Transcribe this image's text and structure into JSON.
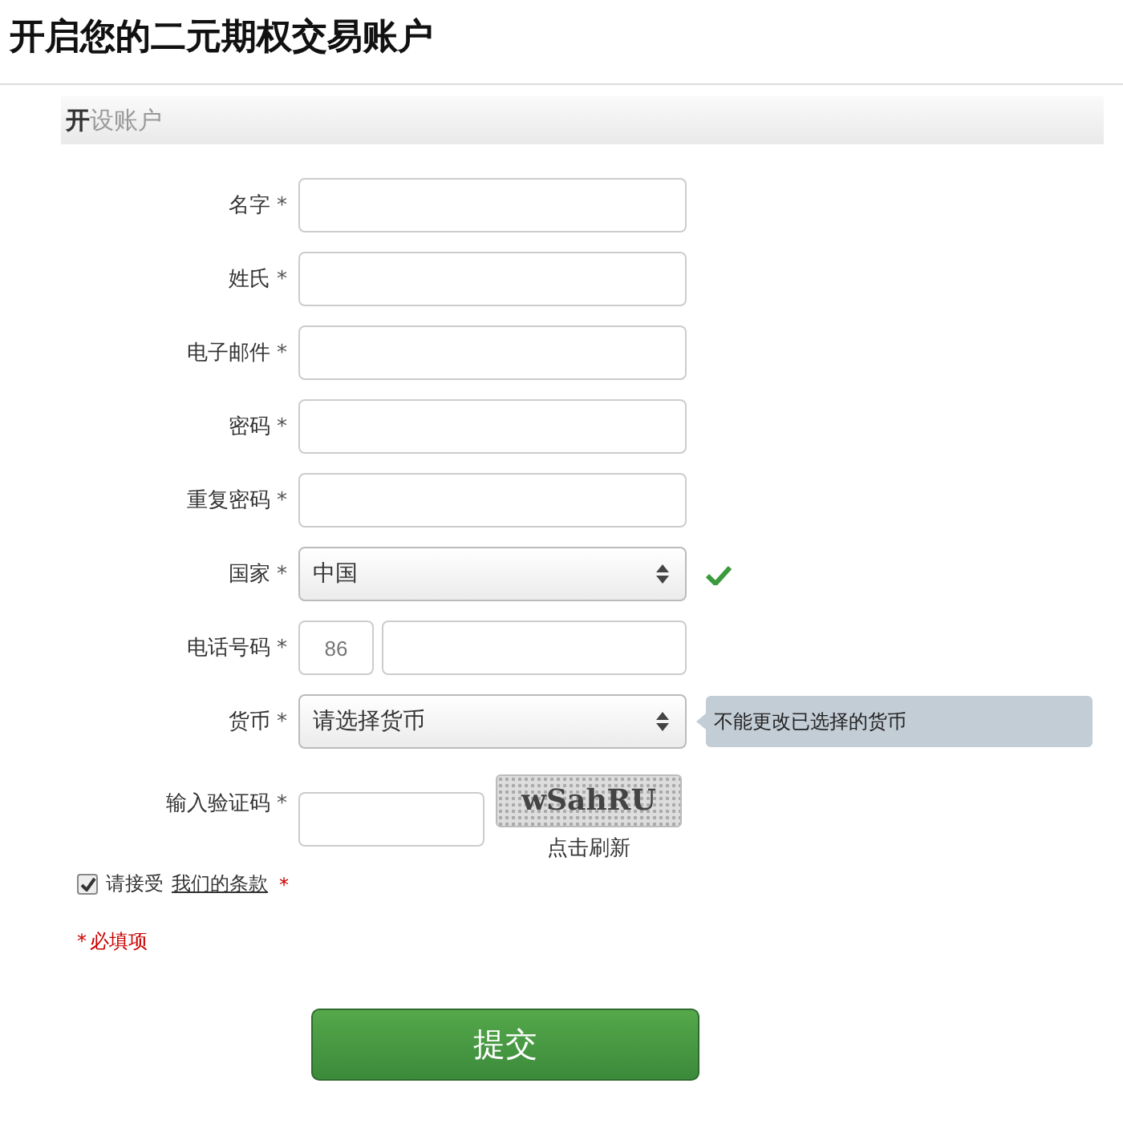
{
  "title": "开启您的二元期权交易账户",
  "section_header": "**开**设账户",
  "fields": [
    {
      "kind": "text",
      "label": "名字",
      "required_mark": "*"
    },
    {
      "kind": "text",
      "label": "姓氏",
      "required_mark": "*"
    },
    {
      "kind": "text",
      "label": "电子邮件",
      "required_mark": "*"
    },
    {
      "kind": "text",
      "label": "密码",
      "required_mark": "*"
    },
    {
      "kind": "text",
      "label": "重复密码",
      "required_mark": "*"
    },
    {
      "kind": "select",
      "label": "国家",
      "required_mark": "*",
      "value": "中国",
      "valid": true
    },
    {
      "kind": "phone",
      "label": "电话号码",
      "required_mark": "*",
      "prefix_placeholder": "86"
    },
    {
      "kind": "select",
      "label": "货币",
      "required_mark": "*",
      "value": "请选择货币",
      "valid": false,
      "tooltip": "不能更改已选择的货币"
    },
    {
      "kind": "captcha",
      "label": "输入验证码",
      "required_mark": "*",
      "captcha_text": "wSahRU",
      "refresh_link": "点击刷新"
    }
  ],
  "terms": {
    "checked": true,
    "text": "请接受",
    "link": "我们的条款",
    "required_mark": "*"
  },
  "required_note": {
    "mark": "*",
    "text": "必填项"
  },
  "submit": "提交"
}
